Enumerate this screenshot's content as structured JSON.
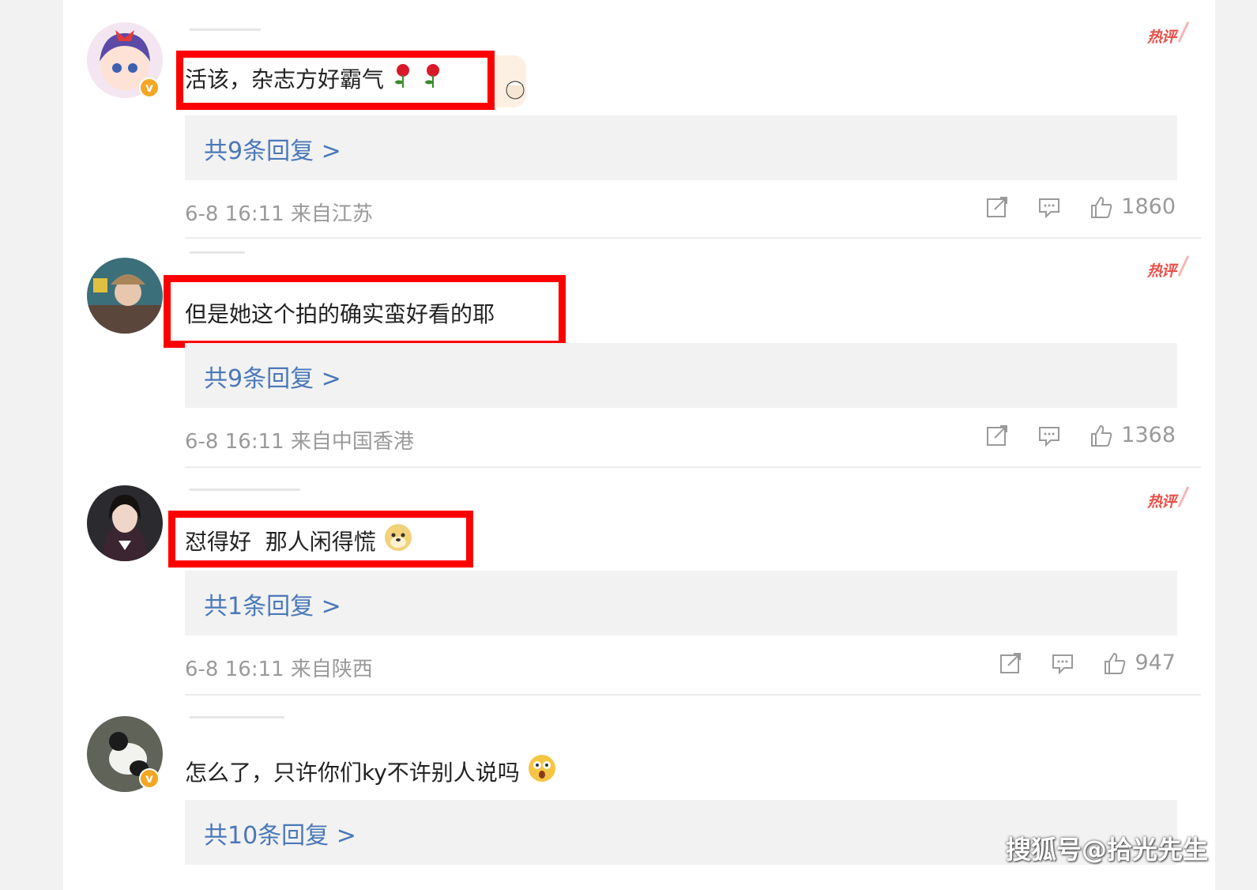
{
  "comments": [
    {
      "text": "活该，杂志方好霸气",
      "hot_label": "热评",
      "replies": "共9条回复 >",
      "meta": "6-8 16:11 来自江苏",
      "likes": "1860",
      "verified": true,
      "highlighted": true
    },
    {
      "text": "但是她这个拍的确实蛮好看的耶",
      "hot_label": "热评",
      "replies": "共9条回复 >",
      "meta": "6-8 16:11 来自中国香港",
      "likes": "1368",
      "verified": false,
      "highlighted": true
    },
    {
      "text": "怼得好  那人闲得慌",
      "hot_label": "热评",
      "replies": "共1条回复 >",
      "meta": "6-8 16:11 来自陕西",
      "likes": "947",
      "verified": false,
      "highlighted": true
    },
    {
      "text": "怎么了，只许你们ky不许别人说吗",
      "hot_label": "",
      "replies": "共10条回复 >",
      "verified": true,
      "highlighted": false
    }
  ],
  "watermark": "搜狐号@拾光先生",
  "icons": {
    "share": "share-icon",
    "comment": "comment-icon",
    "like": "thumbs-up-icon",
    "verified": "verified-badge-icon"
  },
  "colors": {
    "highlight": "#ff0000",
    "link": "#4a78b8",
    "hot": "#e8504a",
    "badge": "#f5a623"
  }
}
